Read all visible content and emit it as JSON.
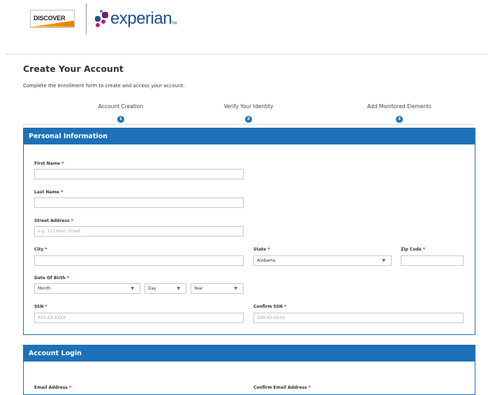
{
  "header": {
    "discover_logo_text": "DISCOVER",
    "experian_logo_text": "experian",
    "experian_tm": "TM"
  },
  "page": {
    "title": "Create Your Account",
    "subtitle": "Complete the enrollment form to create and access your account."
  },
  "steps": [
    {
      "label": "Account Creation",
      "number": "1"
    },
    {
      "label": "Verify Your Identity",
      "number": "2"
    },
    {
      "label": "Add Monitored Elements",
      "number": "3"
    }
  ],
  "personal": {
    "heading": "Personal Information",
    "first_name_label": "First Name",
    "last_name_label": "Last Name",
    "street_label": "Street Address",
    "street_placeholder": "e.g. 123 Main Street",
    "city_label": "City",
    "state_label": "State",
    "state_value": "Alabama",
    "zip_label": "Zip Code",
    "dob_label": "Date Of Birth",
    "month_value": "Month",
    "day_value": "Day",
    "year_value": "Year",
    "ssn_label": "SSN",
    "ssn_placeholder": "XXX-XX-XXXX",
    "confirm_ssn_label": "Confirm SSN",
    "confirm_ssn_placeholder": "XXX-XX-XXXX",
    "required_mark": "*"
  },
  "login": {
    "heading": "Account Login",
    "email_label": "Email Address",
    "confirm_email_label": "Confirm Email Address"
  },
  "colors": {
    "brand_blue": "#1d71b8",
    "required_red": "#c8102e",
    "experian_blue": "#1d4f91"
  }
}
